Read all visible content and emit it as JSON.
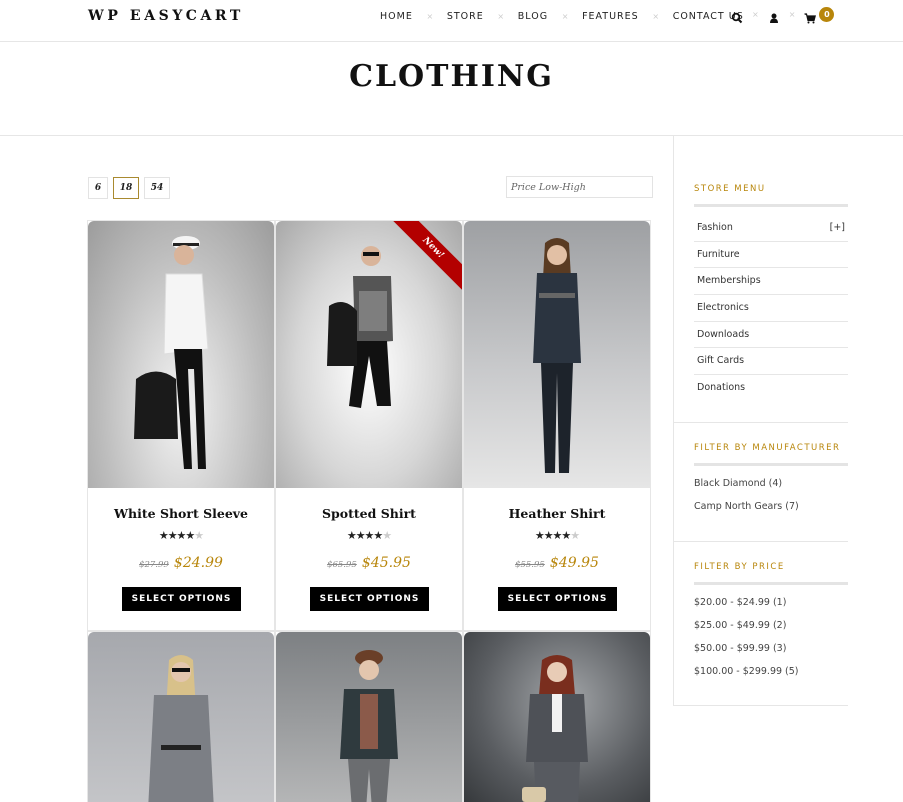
{
  "header": {
    "logo": "WP EASYCART",
    "nav": [
      "HOME",
      "STORE",
      "BLOG",
      "FEATURES",
      "CONTACT US"
    ],
    "cart_count": "0",
    "icons": [
      "search-icon",
      "user-icon",
      "cart-icon"
    ]
  },
  "page": {
    "title": "CLOTHING"
  },
  "toolbar": {
    "per_page": [
      "6",
      "18",
      "54"
    ],
    "per_page_selected": "18",
    "sort_value": "Price Low-High"
  },
  "products": [
    {
      "name": "White Short Sleeve",
      "rating": 4,
      "max_rating": 5,
      "old_price": "$27.99",
      "price": "$24.99",
      "button": "SELECT OPTIONS",
      "badge": ""
    },
    {
      "name": "Spotted Shirt",
      "rating": 4,
      "max_rating": 5,
      "old_price": "$65.95",
      "price": "$45.95",
      "button": "SELECT OPTIONS",
      "badge": "New!"
    },
    {
      "name": "Heather Shirt",
      "rating": 4,
      "max_rating": 5,
      "old_price": "$55.95",
      "price": "$49.95",
      "button": "SELECT OPTIONS",
      "badge": ""
    }
  ],
  "sidebar": {
    "store_menu": {
      "title": "STORE MENU",
      "items": [
        {
          "label": "Fashion",
          "expander": "[+]"
        },
        {
          "label": "Furniture",
          "expander": ""
        },
        {
          "label": "Memberships",
          "expander": ""
        },
        {
          "label": "Electronics",
          "expander": ""
        },
        {
          "label": "Downloads",
          "expander": ""
        },
        {
          "label": "Gift Cards",
          "expander": ""
        },
        {
          "label": "Donations",
          "expander": ""
        }
      ]
    },
    "manufacturer": {
      "title": "FILTER BY MANUFACTURER",
      "items": [
        "Black Diamond (4)",
        "Camp North Gears (7)"
      ]
    },
    "price": {
      "title": "FILTER BY PRICE",
      "items": [
        "$20.00 - $24.99 (1)",
        "$25.00 - $49.99 (2)",
        "$50.00 - $99.99 (3)",
        "$100.00 - $299.99 (5)"
      ]
    }
  },
  "colors": {
    "accent": "#b8860b",
    "ribbon": "#b30000",
    "button": "#000000"
  }
}
